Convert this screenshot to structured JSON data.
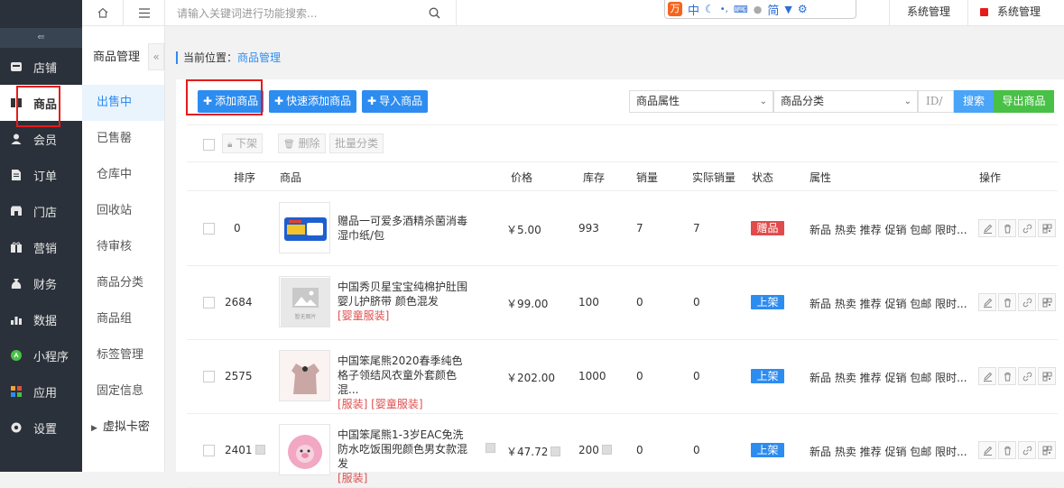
{
  "topbar": {
    "search_placeholder": "请输入关键词进行功能搜索...",
    "ime_chars": [
      "中",
      "简"
    ],
    "system_manage_1": "系统管理",
    "system_manage_2": "系统管理"
  },
  "sidebar": {
    "items": [
      {
        "label": "店铺",
        "icon": "store-icon"
      },
      {
        "label": "商品",
        "icon": "goods-icon",
        "active": true
      },
      {
        "label": "会员",
        "icon": "member-icon"
      },
      {
        "label": "订单",
        "icon": "order-icon"
      },
      {
        "label": "门店",
        "icon": "shop-icon"
      },
      {
        "label": "营销",
        "icon": "gift-icon"
      },
      {
        "label": "财务",
        "icon": "finance-icon"
      },
      {
        "label": "数据",
        "icon": "chart-icon"
      },
      {
        "label": "小程序",
        "icon": "miniapp-icon"
      },
      {
        "label": "应用",
        "icon": "apps-icon"
      },
      {
        "label": "设置",
        "icon": "gear-icon"
      }
    ]
  },
  "subnav": {
    "title": "商品管理",
    "items": [
      "出售中",
      "已售罄",
      "仓库中",
      "回收站",
      "待审核",
      "商品分类",
      "商品组",
      "标签管理",
      "固定信息"
    ],
    "expand_item": "虚拟卡密"
  },
  "breadcrumb": {
    "prefix": "当前位置：",
    "current": "商品管理"
  },
  "toolbar": {
    "add": "添加商品",
    "quick_add": "快速添加商品",
    "import": "导入商品",
    "attr_select": "商品属性",
    "category_select": "商品分类",
    "id_placeholder": "ID/",
    "search": "搜索",
    "export": "导出商品"
  },
  "bulk": {
    "off_shelf": "下架",
    "delete": "删除",
    "batch_category": "批量分类"
  },
  "table": {
    "headers": [
      "排序",
      "商品",
      "价格",
      "库存",
      "销量",
      "实际销量",
      "状态",
      "属性",
      "操作"
    ],
    "rows": [
      {
        "sort": "0",
        "name": "赠品一可爱多酒精杀菌消毒湿巾纸/包",
        "tags": "",
        "price": "￥5.00",
        "stock": "993",
        "sales": "7",
        "real_sales": "7",
        "status": "赠品",
        "status_color": "#e04b4b",
        "attrs": "新品 热卖 推荐 促销 包邮 限时..."
      },
      {
        "sort": "2684",
        "name": "中国秀贝星宝宝纯棉护肚围婴儿护脐带 颜色混发",
        "tags": "[婴童服装]",
        "price": "￥99.00",
        "stock": "100",
        "sales": "0",
        "real_sales": "0",
        "status": "上架",
        "status_color": "#2d8cf0",
        "attrs": "新品 热卖 推荐 促销 包邮 限时...",
        "thumb_text": "暂无图片"
      },
      {
        "sort": "2575",
        "name": "中国笨尾熊2020春季纯色格子领结风衣童外套颜色混...",
        "tags": "[服装] [婴童服装]",
        "price": "￥202.00",
        "stock": "1000",
        "sales": "0",
        "real_sales": "0",
        "status": "上架",
        "status_color": "#2d8cf0",
        "attrs": "新品 热卖 推荐 促销 包邮 限时..."
      },
      {
        "sort": "2401",
        "name": "中国笨尾熊1-3岁EAC免洗防水吃饭围兜颜色男女款混发",
        "tags": "[服装]",
        "price": "￥47.72",
        "stock": "200",
        "sales": "0",
        "real_sales": "0",
        "status": "上架",
        "status_color": "#2d8cf0",
        "attrs": "新品 热卖 推荐 促销 包邮 限时..."
      }
    ]
  },
  "colors": {
    "accent": "#2d8cf0",
    "export_green": "#49c046",
    "highlight_red": "#e41b1b",
    "sidebar_bg": "#2b313a"
  }
}
